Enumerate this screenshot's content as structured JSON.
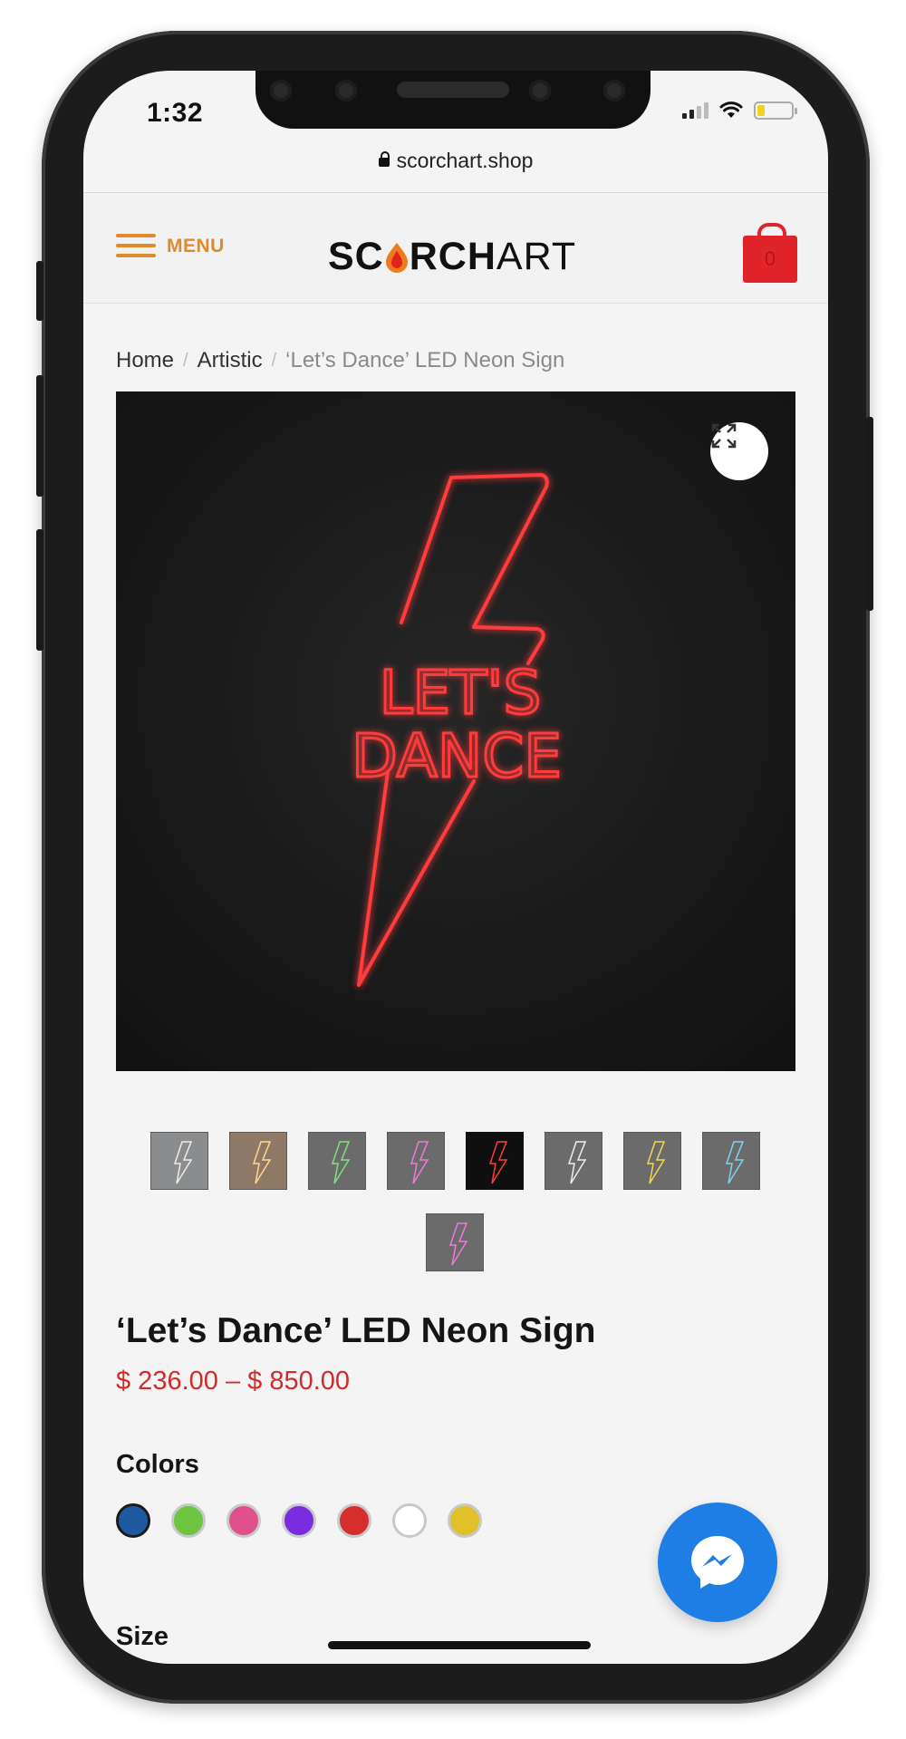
{
  "status_bar": {
    "time": "1:32"
  },
  "browser": {
    "url": "scorchart.shop"
  },
  "header": {
    "menu_label": "MENU",
    "logo": {
      "part1": "SC",
      "part2": "RCH",
      "part3": "ART"
    },
    "cart_count": "0"
  },
  "breadcrumb": {
    "home": "Home",
    "category": "Artistic",
    "current": "‘Let’s Dance’ LED Neon Sign"
  },
  "product": {
    "image_text_line1": "LET'S",
    "image_text_line2": "DANCE",
    "title": "‘Let’s Dance’ LED Neon Sign",
    "price_range": "$ 236.00 – $ 850.00",
    "colors_label": "Colors",
    "size_label": "Size",
    "colors": [
      "#1f5aa0",
      "#6cc43f",
      "#e0508a",
      "#7a2be0",
      "#d62d2d",
      "#ffffff",
      "#e0c12a"
    ],
    "thumbnails": [
      "white",
      "warm",
      "green",
      "pink",
      "red",
      "white",
      "yellow",
      "blue",
      "pink"
    ],
    "selected_thumbnail": "red"
  },
  "colors": {
    "accent": "#e08a2a",
    "cart": "#e0242a",
    "price": "#d32a2a",
    "messenger": "#1f7ee5",
    "neon": "#ff3b3b"
  }
}
